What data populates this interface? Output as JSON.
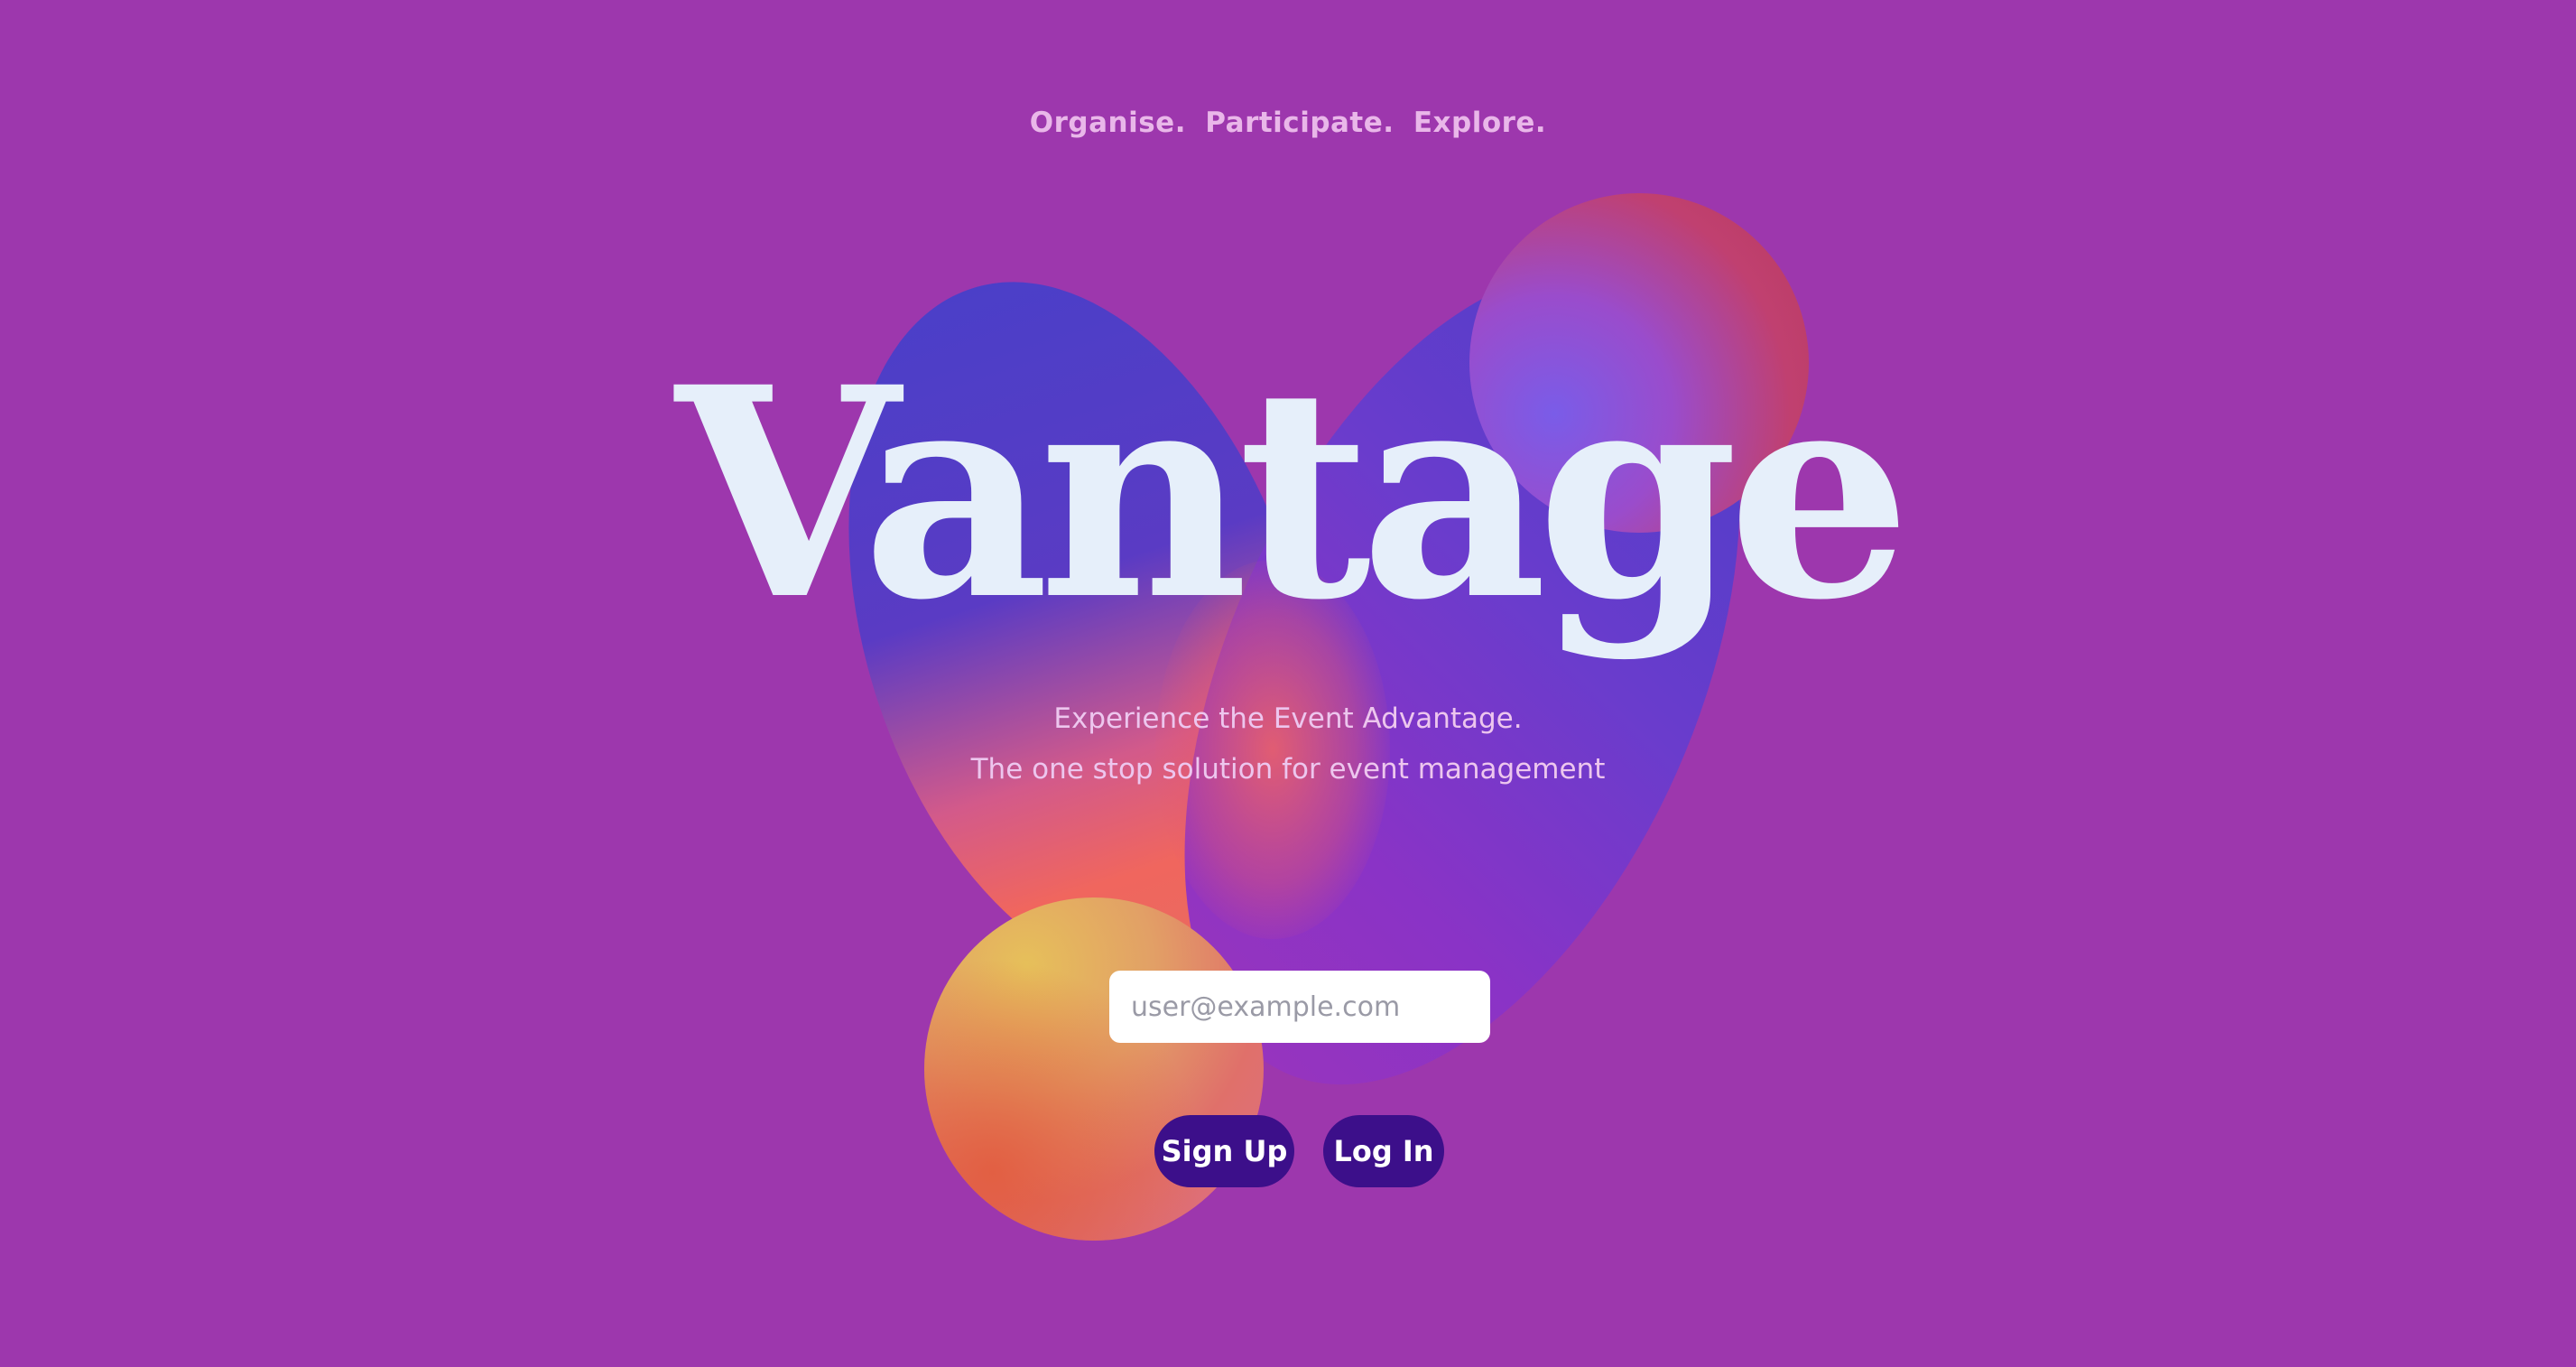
{
  "header": {
    "tagline": "Organise.  Participate.  Explore."
  },
  "hero": {
    "brand_title": "Vantage",
    "subtitle_line1": "Experience the Event Advantage.",
    "subtitle_line2": "The one stop solution for event management"
  },
  "auth_form": {
    "email_placeholder": "user@example.com",
    "email_value": "",
    "signup_label": "Sign Up",
    "login_label": "Log In"
  },
  "colors": {
    "background": "#9d37ad",
    "button": "#3c0f8a",
    "title_text": "#e6effa",
    "subtitle_text": "#edc6ee"
  }
}
